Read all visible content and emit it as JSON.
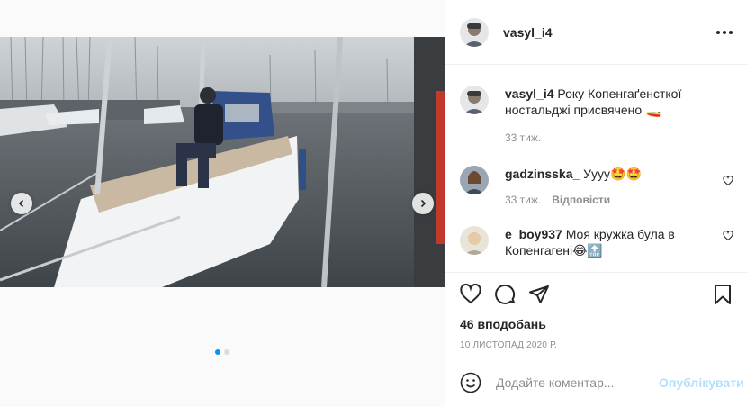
{
  "post": {
    "author": "vasyl_i4",
    "caption_text": "Року Копенгаґенсткої ностальджі присвячено",
    "caption_emoji": "🚤",
    "caption_time": "33 тиж.",
    "likes": "46 вподобань",
    "date": "10 ЛИСТОПАД 2020 Р.",
    "carousel": {
      "total": 2,
      "current": 1
    }
  },
  "comments": [
    {
      "user": "gadzinsska_",
      "text": "Уууу",
      "emoji": "🤩🤩",
      "time": "33 тиж.",
      "reply": "Відповісти"
    },
    {
      "user": "e_boy937",
      "text": "Моя кружка була в Копенгагені",
      "emoji": "😂🔝",
      "time": "",
      "reply": ""
    }
  ],
  "add_comment": {
    "placeholder": "Додайте коментар...",
    "post_label": "Опублікувати"
  },
  "icons": {
    "more": "more-options-icon",
    "like": "heart-icon",
    "comment": "comment-icon",
    "share": "share-icon",
    "save": "bookmark-icon",
    "emoji": "smiley-icon",
    "prev": "chevron-left-icon",
    "next": "chevron-right-icon"
  },
  "colors": {
    "accent": "#0095f6",
    "post_disabled": "#b2dffc",
    "muted": "#8e8e8e",
    "border": "#efefef"
  }
}
